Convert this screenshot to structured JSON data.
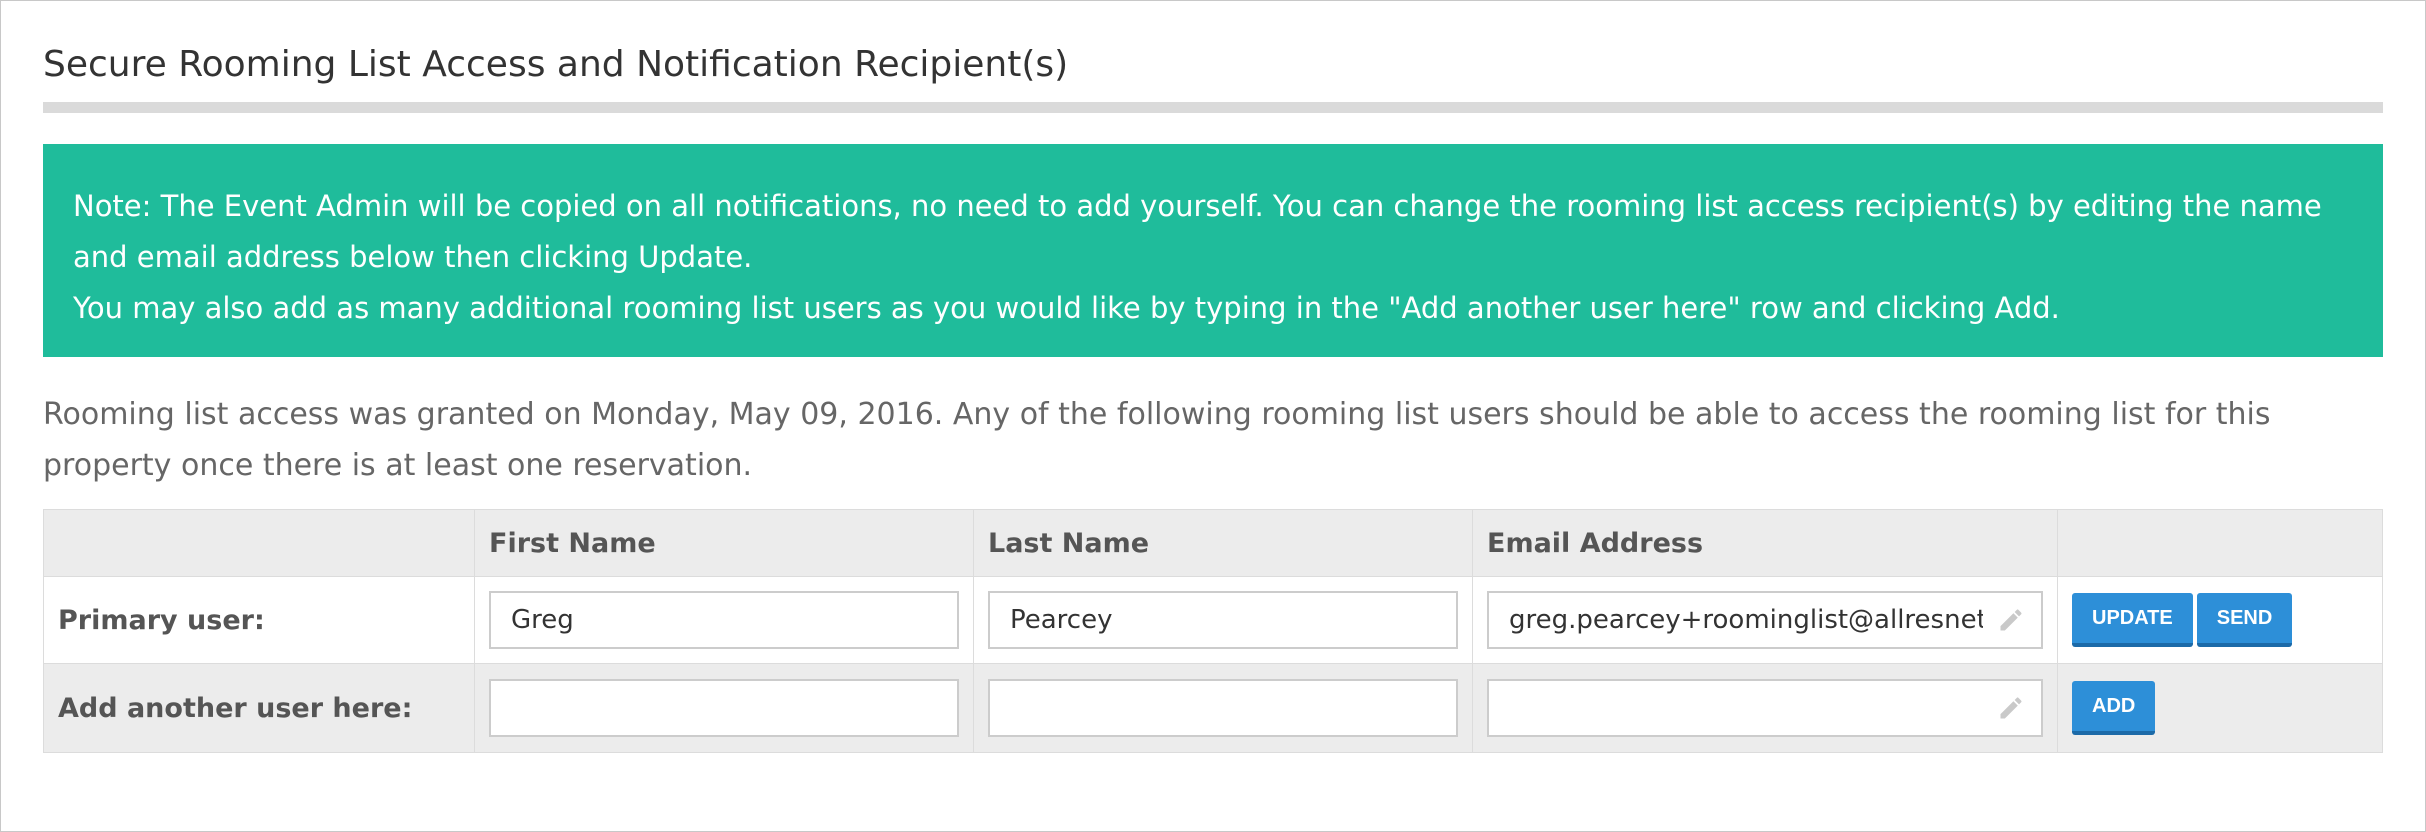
{
  "section": {
    "title": "Secure Rooming List Access and Notification Recipient(s)"
  },
  "note": {
    "line1": "Note: The Event Admin will be copied on all notifications, no need to add yourself. You can change the rooming list access recipient(s) by editing the name and email address below then clicking Update.",
    "line2": "You may also add as many additional rooming list users as you would like by typing in the \"Add another user here\" row and clicking Add."
  },
  "info_text": "Rooming list access was granted on Monday, May 09, 2016. Any of the following rooming list users should be able to access the rooming list for this property once there is at least one reservation.",
  "table": {
    "headers": [
      "",
      "First Name",
      "Last Name",
      "Email Address",
      ""
    ],
    "primary": {
      "label": "Primary user:",
      "first_name": "Greg",
      "last_name": "Pearcey",
      "email": "greg.pearcey+roominglist@allresnet.con",
      "update_label": "UPDATE",
      "send_label": "SEND"
    },
    "add": {
      "label": "Add another user here:",
      "first_name": "",
      "last_name": "",
      "email": "",
      "add_label": "ADD"
    }
  },
  "colors": {
    "note_bg": "#1fbc9b",
    "button_bg": "#2d8fd8",
    "header_bg": "#ececec"
  },
  "icons": {
    "email_edit": "pencil-icon"
  }
}
